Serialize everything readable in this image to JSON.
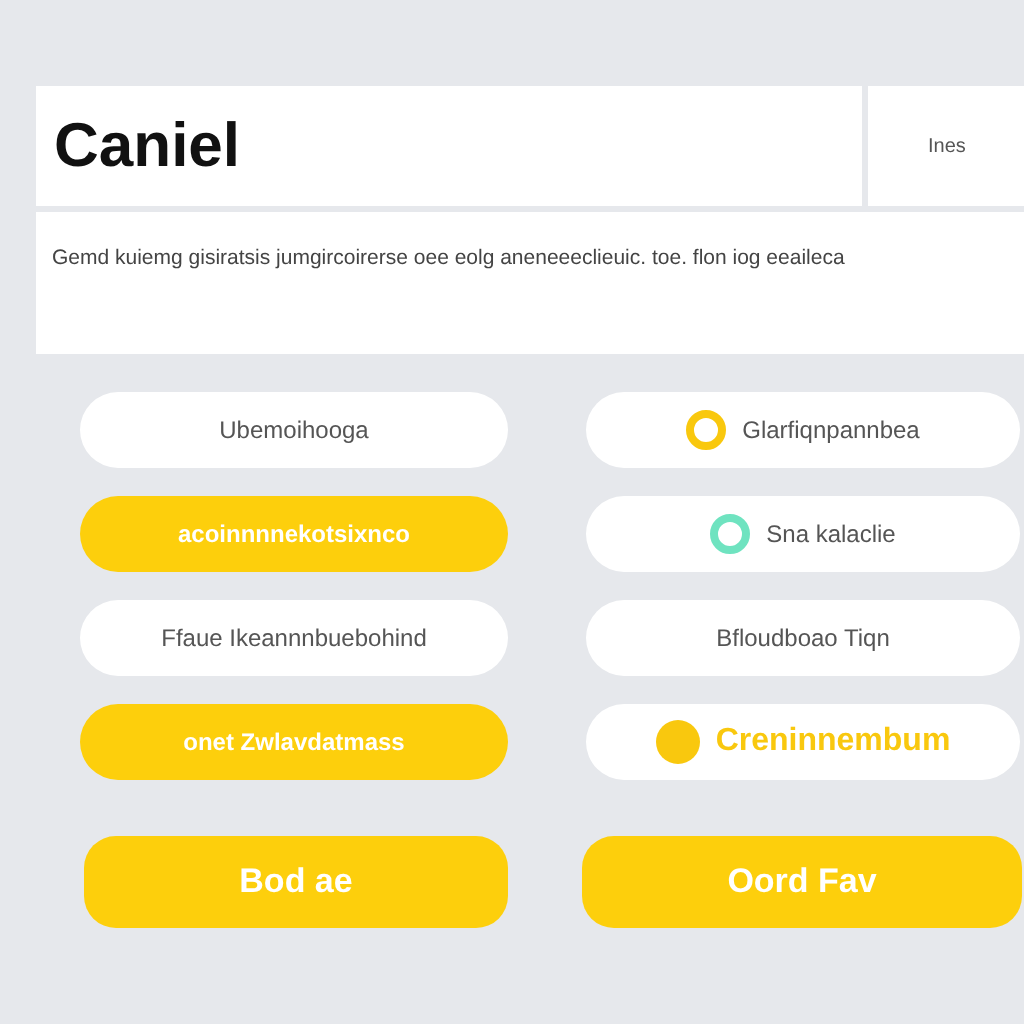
{
  "header": {
    "title": "Caniel",
    "side_label": "Ines"
  },
  "description": "Gemd kuiemg gisiratsis jumgircoirerse oee eolg aneneeeclieuic. toe. flon iog eeaileca",
  "options": [
    {
      "label": "Ubemoihooga",
      "selected": false,
      "kind": "plain"
    },
    {
      "label": "Glarfiqnpannbea",
      "selected": false,
      "kind": "ring",
      "color": "#f9c80e"
    },
    {
      "label": "acoinnnnekotsixnco",
      "selected": true,
      "kind": "plain"
    },
    {
      "label": "Sna kalaclie",
      "selected": false,
      "kind": "ring",
      "color": "#6fe3c0"
    },
    {
      "label": "Ffaue Ikeannnbuebohind",
      "selected": false,
      "kind": "plain"
    },
    {
      "label": "Bfloudboao Tiqn",
      "selected": false,
      "kind": "plain"
    },
    {
      "label": "onet Zwlavdatmass",
      "selected": true,
      "kind": "plain"
    },
    {
      "label": "Creninnembum",
      "selected": false,
      "kind": "dot",
      "color": "#f9c80e"
    }
  ],
  "buttons": [
    "Bod ae",
    "Oord Fav"
  ]
}
